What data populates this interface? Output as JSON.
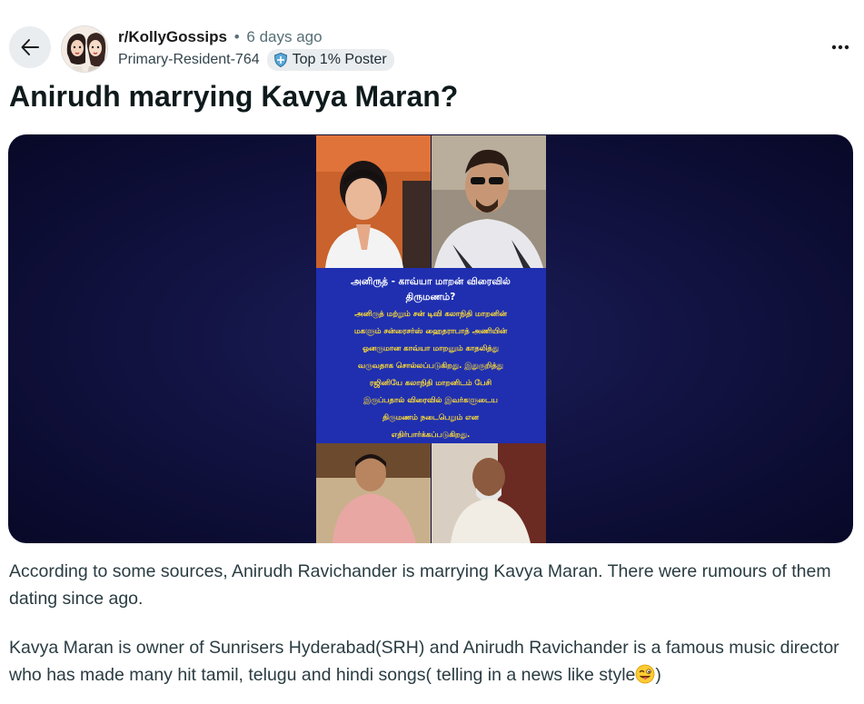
{
  "post": {
    "subreddit": "r/KollyGossips",
    "separator": "•",
    "time_ago": "6 days ago",
    "author": "Primary-Resident-764",
    "flair": "Top 1% Poster",
    "title": "Anirudh marrying Kavya Maran?",
    "body": [
      "According to some sources, Anirudh Ravichander is marrying Kavya Maran. There were rumours of them dating since ago.",
      "Kavya Maran is owner of Sunrisers Hyderabad(SRH) and Anirudh Ravichander is a famous music director who has made many hit tamil, telugu and hindi songs( telling in a news like style"
    ],
    "body_closing": ")"
  },
  "image": {
    "headline_line1": "அனிருத் - காவ்யா மாறன் விரைவில்",
    "headline_line2": "திருமணம்?",
    "text_lines": [
      "அனிருத் மற்றும் சன் டிவி கலாநிதி மாறனின்",
      "மகளும் சன்ரைசர்ஸ் ஹைதராபாத் அணியின்",
      "ஓனருமான காவ்யா மாறனும் காதலித்து",
      "வருவதாக சொல்லப்படுகிறது. இதுகுறித்து",
      "ரஜினியே கலாநிதி மாறனிடம் பேசி",
      "இருப்பதால் விரைவில் இவர்களுடைய",
      "திருமணம் நடைபெறும் என",
      "எதிர்பார்க்கப்படுகிறது."
    ]
  },
  "colors": {
    "poster_blue": "#1f2fb0",
    "poster_text": "#ffdd33",
    "emoji": "#ffcc33"
  },
  "icons": {
    "back": "arrow-left-icon",
    "more": "more-horizontal-icon",
    "flair": "shield-badge-icon",
    "emoji": "tongue-wink-emoji"
  }
}
